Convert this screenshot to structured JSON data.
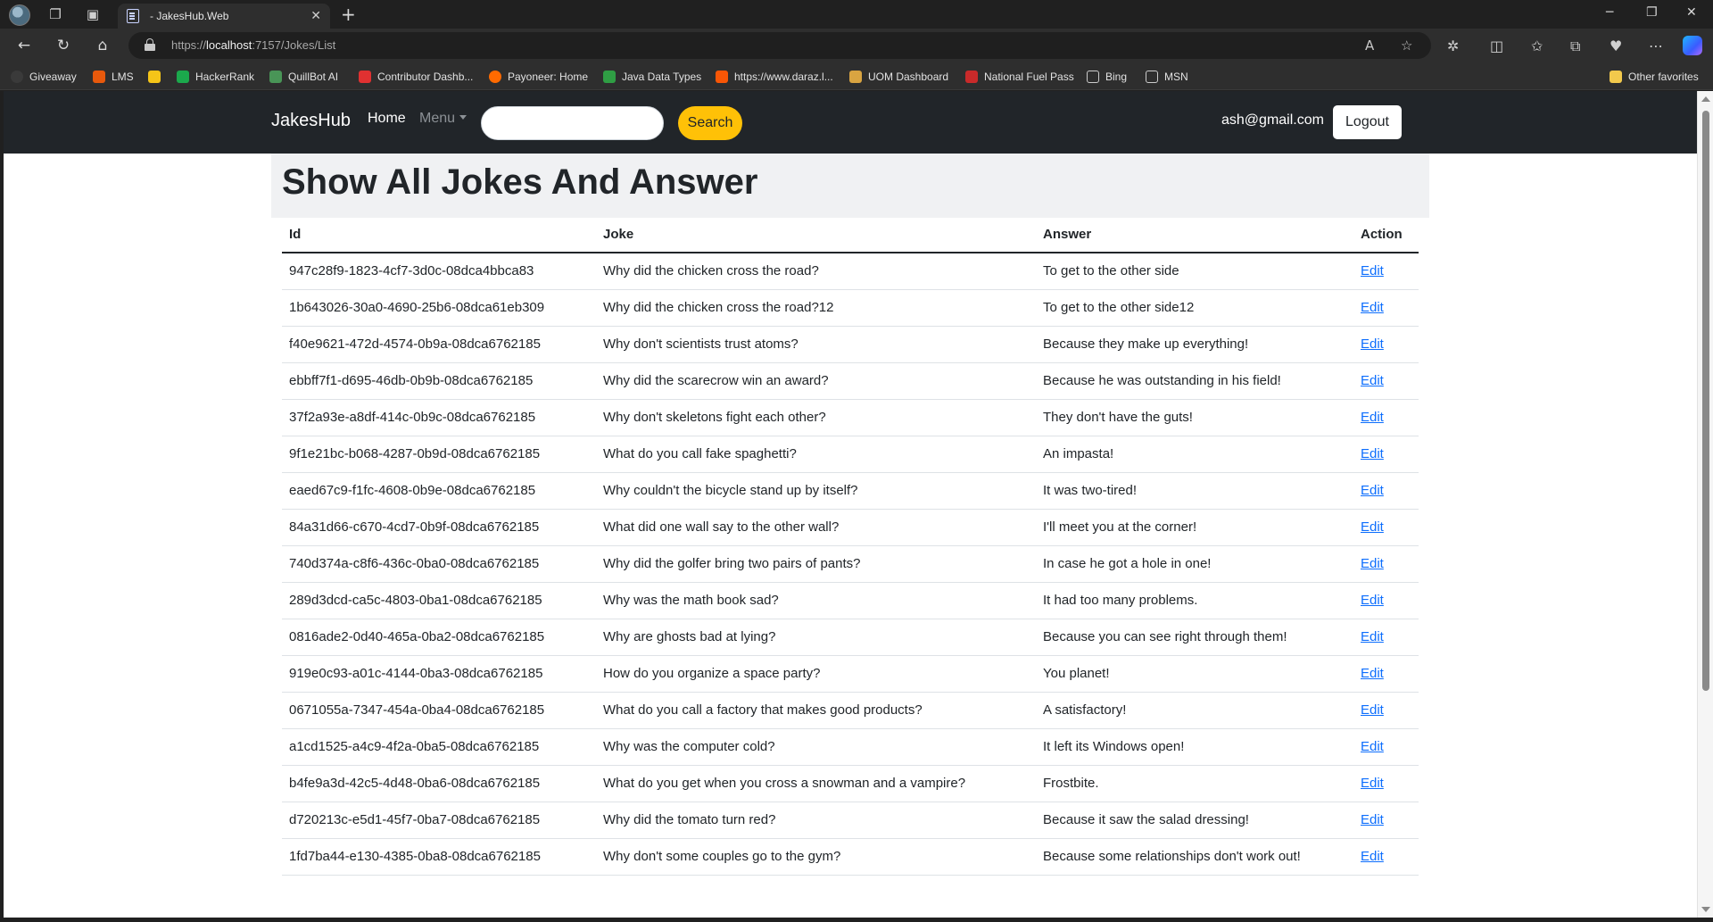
{
  "browser": {
    "tab_title": "- JakesHub.Web",
    "tab_close": "✕",
    "new_tab": "+",
    "url_prefix": "https://",
    "url_host": "localhost",
    "url_path": ":7157/Jokes/List",
    "favorites": [
      {
        "label": "Giveaway",
        "color": "#3a3a3a"
      },
      {
        "label": "LMS",
        "color": "#e8590c"
      },
      {
        "label": "",
        "color": "#f5c518"
      },
      {
        "label": "HackerRank",
        "color": "#1ba94c"
      },
      {
        "label": "QuillBot AI",
        "color": "#499557"
      },
      {
        "label": "Contributor Dashb...",
        "color": "#e03131"
      },
      {
        "label": "Payoneer: Home",
        "color": "#ff6a00"
      },
      {
        "label": "Java Data Types",
        "color": "#2f9e44"
      },
      {
        "label": "https://www.daraz.l...",
        "color": "#f85606"
      },
      {
        "label": "UOM Dashboard",
        "color": "#d9a441"
      },
      {
        "label": "National Fuel Pass",
        "color": "#c92a2a"
      },
      {
        "label": "Bing",
        "color": "#cccccc"
      },
      {
        "label": "MSN",
        "color": "#cccccc"
      }
    ],
    "other_favorites": "Other favorites"
  },
  "site": {
    "brand": "JakesHub",
    "nav_home": "Home",
    "nav_menu": "Menu",
    "search_value": "",
    "search_button": "Search",
    "user_email": "ash@gmail.com",
    "logout_button": "Logout",
    "accent": "#ffc107",
    "navbar_bg": "#212529"
  },
  "page": {
    "title": "Show All Jokes And Answer",
    "columns": [
      "Id",
      "Joke",
      "Answer",
      "Action"
    ],
    "action_label": "Edit",
    "rows": [
      {
        "id": "947c28f9-1823-4cf7-3d0c-08dca4bbca83",
        "joke": "Why did the chicken cross the road?",
        "answer": "To get to the other side"
      },
      {
        "id": "1b643026-30a0-4690-25b6-08dca61eb309",
        "joke": "Why did the chicken cross the road?12",
        "answer": "To get to the other side12"
      },
      {
        "id": "f40e9621-472d-4574-0b9a-08dca6762185",
        "joke": "Why don't scientists trust atoms?",
        "answer": "Because they make up everything!"
      },
      {
        "id": "ebbff7f1-d695-46db-0b9b-08dca6762185",
        "joke": "Why did the scarecrow win an award?",
        "answer": "Because he was outstanding in his field!"
      },
      {
        "id": "37f2a93e-a8df-414c-0b9c-08dca6762185",
        "joke": "Why don't skeletons fight each other?",
        "answer": "They don't have the guts!"
      },
      {
        "id": "9f1e21bc-b068-4287-0b9d-08dca6762185",
        "joke": "What do you call fake spaghetti?",
        "answer": "An impasta!"
      },
      {
        "id": "eaed67c9-f1fc-4608-0b9e-08dca6762185",
        "joke": "Why couldn't the bicycle stand up by itself?",
        "answer": "It was two-tired!"
      },
      {
        "id": "84a31d66-c670-4cd7-0b9f-08dca6762185",
        "joke": "What did one wall say to the other wall?",
        "answer": "I'll meet you at the corner!"
      },
      {
        "id": "740d374a-c8f6-436c-0ba0-08dca6762185",
        "joke": "Why did the golfer bring two pairs of pants?",
        "answer": "In case he got a hole in one!"
      },
      {
        "id": "289d3dcd-ca5c-4803-0ba1-08dca6762185",
        "joke": "Why was the math book sad?",
        "answer": "It had too many problems."
      },
      {
        "id": "0816ade2-0d40-465a-0ba2-08dca6762185",
        "joke": "Why are ghosts bad at lying?",
        "answer": "Because you can see right through them!"
      },
      {
        "id": "919e0c93-a01c-4144-0ba3-08dca6762185",
        "joke": "How do you organize a space party?",
        "answer": "You planet!"
      },
      {
        "id": "0671055a-7347-454a-0ba4-08dca6762185",
        "joke": "What do you call a factory that makes good products?",
        "answer": "A satisfactory!"
      },
      {
        "id": "a1cd1525-a4c9-4f2a-0ba5-08dca6762185",
        "joke": "Why was the computer cold?",
        "answer": "It left its Windows open!"
      },
      {
        "id": "b4fe9a3d-42c5-4d48-0ba6-08dca6762185",
        "joke": "What do you get when you cross a snowman and a vampire?",
        "answer": "Frostbite."
      },
      {
        "id": "d720213c-e5d1-45f7-0ba7-08dca6762185",
        "joke": "Why did the tomato turn red?",
        "answer": "Because it saw the salad dressing!"
      },
      {
        "id": "1fd7ba44-e130-4385-0ba8-08dca6762185",
        "joke": "Why don't some couples go to the gym?",
        "answer": "Because some relationships don't work out!"
      }
    ]
  }
}
